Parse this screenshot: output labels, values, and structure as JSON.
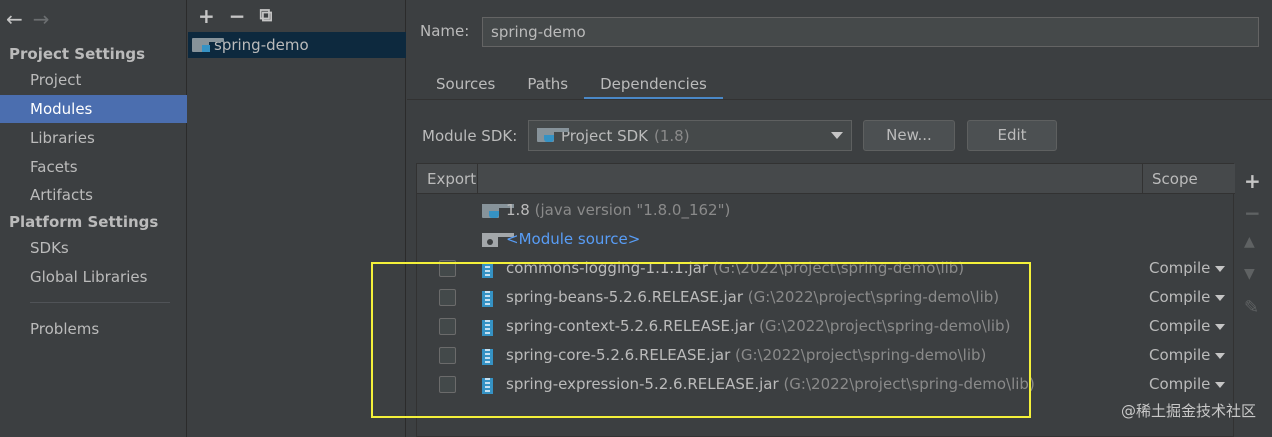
{
  "nav": {
    "back_icon": "←",
    "forward_icon": "→"
  },
  "sidebar": {
    "project_settings_header": "Project Settings",
    "project_items": [
      "Project",
      "Modules",
      "Libraries",
      "Facets",
      "Artifacts"
    ],
    "platform_settings_header": "Platform Settings",
    "platform_items": [
      "SDKs",
      "Global Libraries"
    ],
    "problems": "Problems",
    "selected": "Modules"
  },
  "module_list": {
    "toolbar": {
      "add": "+",
      "remove": "−",
      "copy": "⧉"
    },
    "items": [
      "spring-demo"
    ]
  },
  "main": {
    "name_label": "Name:",
    "name_value": "spring-demo",
    "tabs": [
      "Sources",
      "Paths",
      "Dependencies"
    ],
    "active_tab": "Dependencies",
    "sdk_label": "Module SDK:",
    "sdk_value": "Project SDK",
    "sdk_version": "(1.8)",
    "new_button": "New...",
    "edit_button": "Edit"
  },
  "table": {
    "col_export": "Export",
    "col_scope": "Scope",
    "rows": [
      {
        "name": "1.8",
        "detail": "(java version \"1.8.0_162\")",
        "type": "jdk"
      },
      {
        "name": "<Module source>",
        "type": "source"
      },
      {
        "name": "commons-logging-1.1.1.jar",
        "detail": "(G:\\2022\\project\\spring-demo\\lib)",
        "scope": "Compile",
        "type": "jar"
      },
      {
        "name": "spring-beans-5.2.6.RELEASE.jar",
        "detail": "(G:\\2022\\project\\spring-demo\\lib)",
        "scope": "Compile",
        "type": "jar"
      },
      {
        "name": "spring-context-5.2.6.RELEASE.jar",
        "detail": "(G:\\2022\\project\\spring-demo\\lib)",
        "scope": "Compile",
        "type": "jar"
      },
      {
        "name": "spring-core-5.2.6.RELEASE.jar",
        "detail": "(G:\\2022\\project\\spring-demo\\lib)",
        "scope": "Compile",
        "type": "jar"
      },
      {
        "name": "spring-expression-5.2.6.RELEASE.jar",
        "detail": "(G:\\2022\\project\\spring-demo\\lib)",
        "scope": "Compile",
        "type": "jar"
      }
    ]
  },
  "right_toolbar": {
    "add": "+",
    "remove": "−",
    "up": "▲",
    "down": "▼",
    "edit": "✎"
  },
  "watermark": "@稀土掘金技术社区",
  "colors": {
    "selection": "#4b6eaf",
    "highlight": "#f4f13a",
    "link": "#589df6"
  }
}
